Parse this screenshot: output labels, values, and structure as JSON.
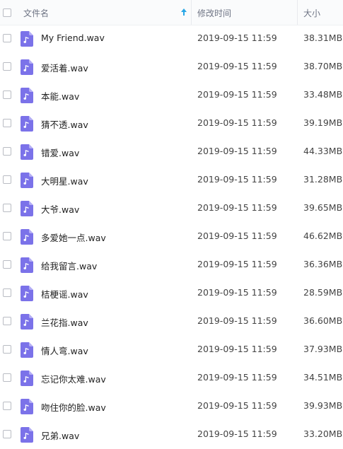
{
  "header": {
    "name_label": "文件名",
    "time_label": "修改时间",
    "size_label": "大小",
    "sort_icon": "arrow-up-icon"
  },
  "colors": {
    "file_icon": "#7b72e9",
    "sort_accent": "#2aa7e6"
  },
  "files": [
    {
      "name": "My Friend.wav",
      "modified": "2019-09-15 11:59",
      "size": "38.31MB"
    },
    {
      "name": "爱活着.wav",
      "modified": "2019-09-15 11:59",
      "size": "38.70MB"
    },
    {
      "name": "本能.wav",
      "modified": "2019-09-15 11:59",
      "size": "33.48MB"
    },
    {
      "name": "猜不透.wav",
      "modified": "2019-09-15 11:59",
      "size": "39.19MB"
    },
    {
      "name": "错爱.wav",
      "modified": "2019-09-15 11:59",
      "size": "44.33MB"
    },
    {
      "name": "大明星.wav",
      "modified": "2019-09-15 11:59",
      "size": "31.28MB"
    },
    {
      "name": "大爷.wav",
      "modified": "2019-09-15 11:59",
      "size": "39.65MB"
    },
    {
      "name": "多爱她一点.wav",
      "modified": "2019-09-15 11:59",
      "size": "46.62MB"
    },
    {
      "name": "给我留言.wav",
      "modified": "2019-09-15 11:59",
      "size": "36.36MB"
    },
    {
      "name": "桔梗谣.wav",
      "modified": "2019-09-15 11:59",
      "size": "28.59MB"
    },
    {
      "name": "兰花指.wav",
      "modified": "2019-09-15 11:59",
      "size": "36.60MB"
    },
    {
      "name": "情人弯.wav",
      "modified": "2019-09-15 11:59",
      "size": "37.93MB"
    },
    {
      "name": "忘记你太难.wav",
      "modified": "2019-09-15 11:59",
      "size": "34.51MB"
    },
    {
      "name": "吻住你的脸.wav",
      "modified": "2019-09-15 11:59",
      "size": "39.93MB"
    },
    {
      "name": "兄弟.wav",
      "modified": "2019-09-15 11:59",
      "size": "33.20MB"
    }
  ]
}
